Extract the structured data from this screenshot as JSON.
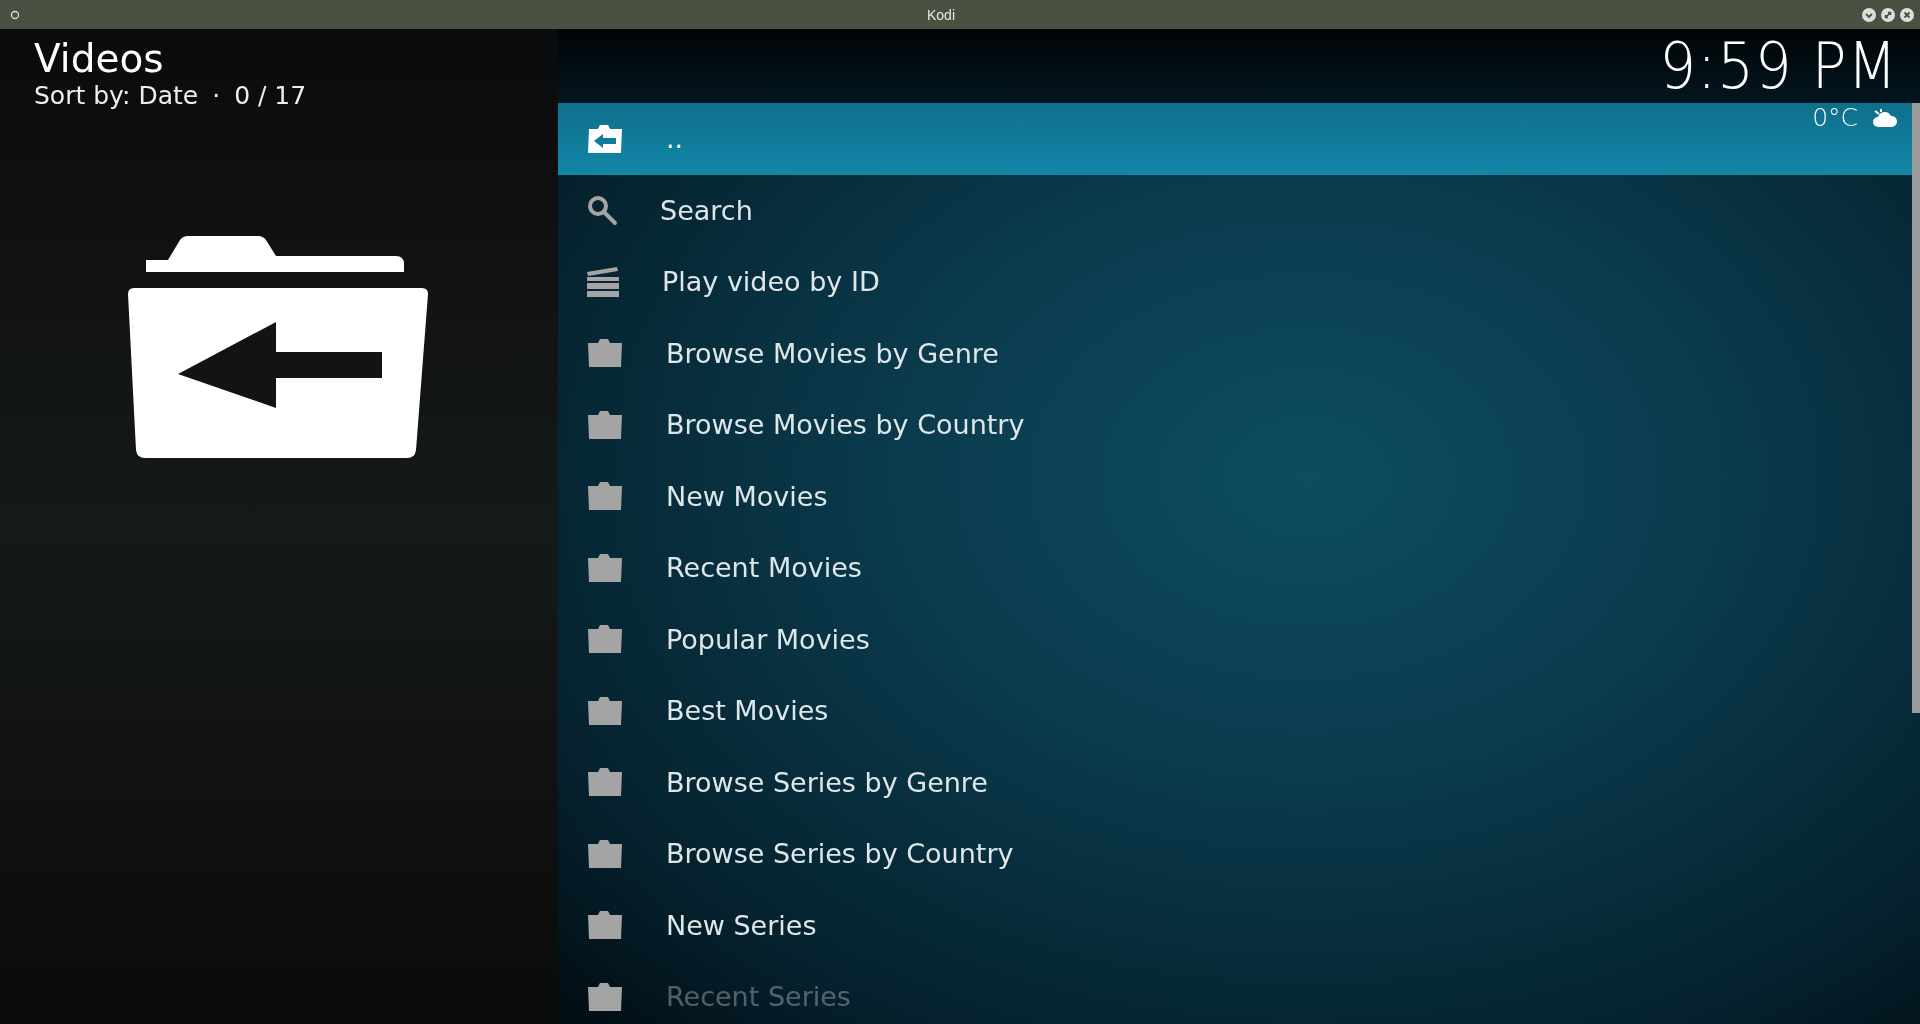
{
  "window": {
    "title": "Kodi"
  },
  "header": {
    "title": "Videos",
    "sort": "Sort by: Date",
    "separator": "·",
    "counter": "0 / 17"
  },
  "clock": "9:59 PM",
  "weather": {
    "temperature": "0°C"
  },
  "items": [
    {
      "label": "..",
      "kind": "back",
      "selected": true
    },
    {
      "label": "Search",
      "kind": "search",
      "selected": false
    },
    {
      "label": "Play video by ID",
      "kind": "clapper",
      "selected": false
    },
    {
      "label": "Browse Movies by Genre",
      "kind": "folder",
      "selected": false
    },
    {
      "label": "Browse Movies by Country",
      "kind": "folder",
      "selected": false
    },
    {
      "label": "New Movies",
      "kind": "folder",
      "selected": false
    },
    {
      "label": "Recent Movies",
      "kind": "folder",
      "selected": false
    },
    {
      "label": "Popular Movies",
      "kind": "folder",
      "selected": false
    },
    {
      "label": "Best Movies",
      "kind": "folder",
      "selected": false
    },
    {
      "label": "Browse Series by Genre",
      "kind": "folder",
      "selected": false
    },
    {
      "label": "Browse Series by Country",
      "kind": "folder",
      "selected": false
    },
    {
      "label": "New Series",
      "kind": "folder",
      "selected": false
    },
    {
      "label": "Recent Series",
      "kind": "folder",
      "selected": false
    }
  ]
}
